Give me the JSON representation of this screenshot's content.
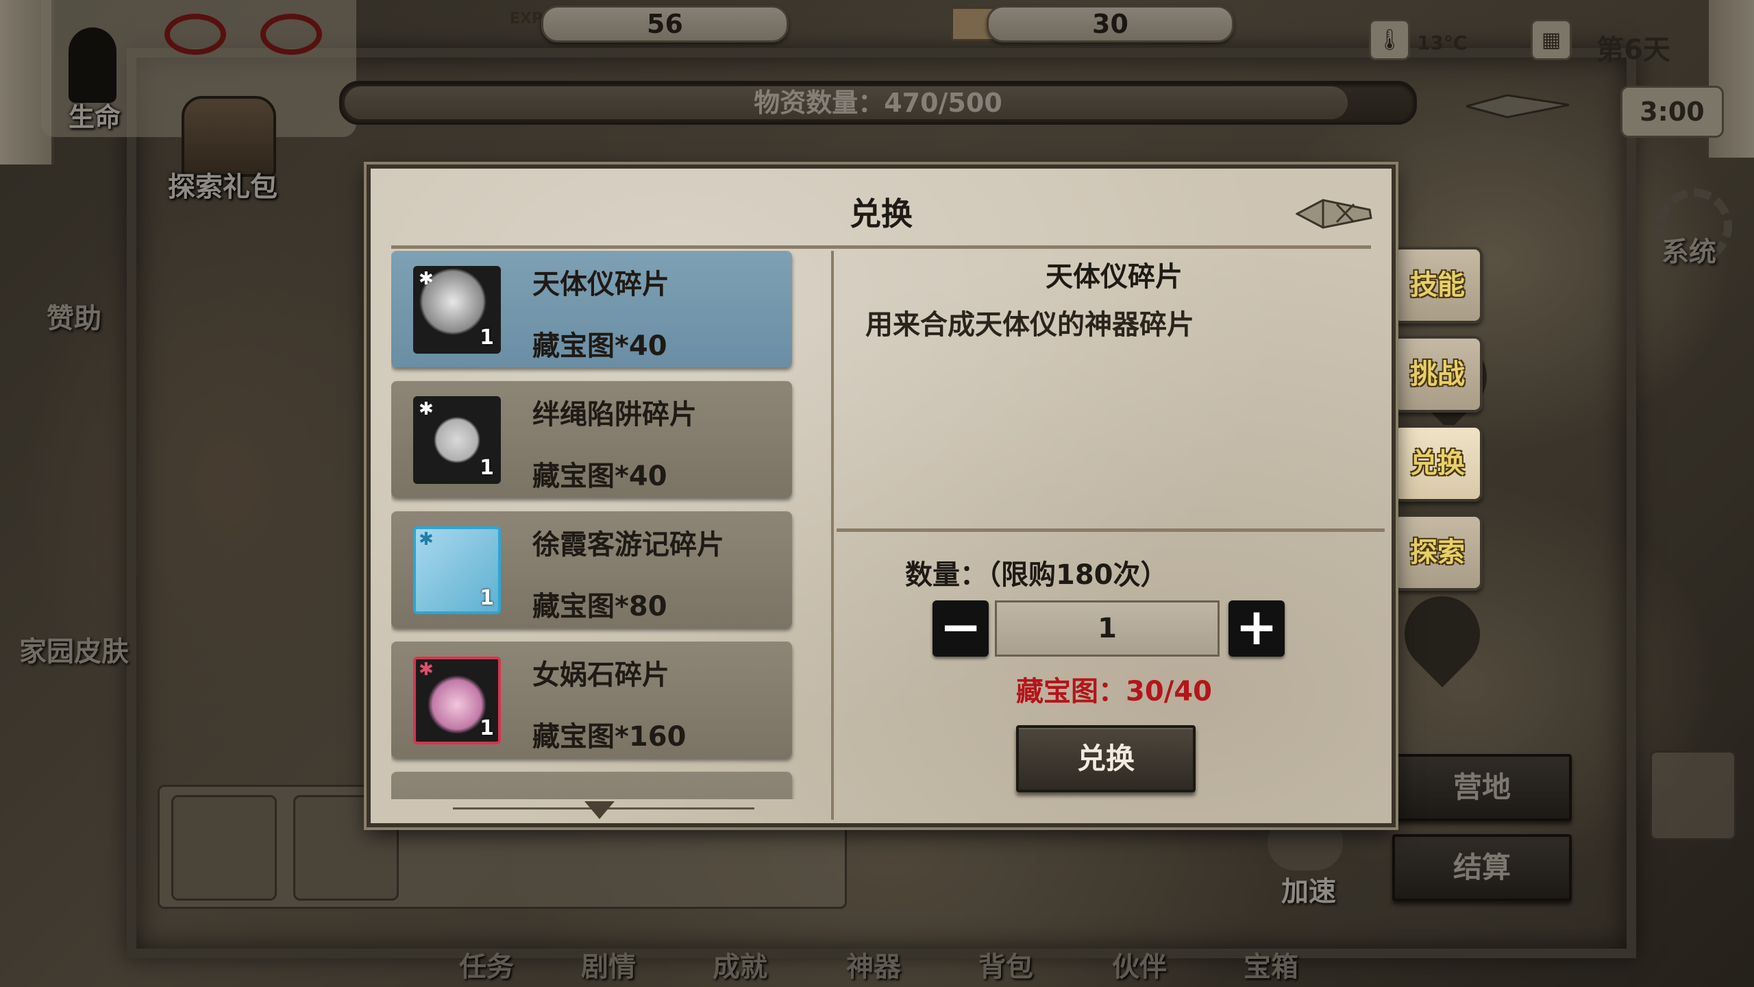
{
  "hud": {
    "exp_icon_text": "EXP",
    "exp_value": "56",
    "scroll_value": "30",
    "temperature": "13°C",
    "day": "第6天",
    "time": "3:00",
    "life_label": "生命"
  },
  "resource": {
    "text": "物资数量：470/500",
    "fill_fraction": 0.94
  },
  "left_side": {
    "gift_label": "探索礼包",
    "sponsor_label": "赞助",
    "skin_label": "家园皮肤"
  },
  "right_side": {
    "system_label": "系统",
    "camp_label": "营地",
    "settle_label": "结算",
    "speed_label": "加速"
  },
  "dialog": {
    "title": "兑换",
    "items": [
      {
        "name": "天体仪碎片",
        "cost": "藏宝图*40",
        "qty": "1",
        "icon": "celestial-globe-icon",
        "frame": "#1b1b1b",
        "selected": true
      },
      {
        "name": "绊绳陷阱碎片",
        "cost": "藏宝图*40",
        "qty": "1",
        "icon": "rope-trap-icon",
        "frame": "#1b1b1b",
        "selected": false
      },
      {
        "name": "徐霞客游记碎片",
        "cost": "藏宝图*80",
        "qty": "1",
        "icon": "travel-journal-icon",
        "frame": "#2aa7d6",
        "selected": false
      },
      {
        "name": "女娲石碎片",
        "cost": "藏宝图*160",
        "qty": "1",
        "icon": "nuwa-stone-icon",
        "frame": "#d6344e",
        "selected": false
      }
    ],
    "detail_name": "天体仪碎片",
    "detail_desc": "用来合成天体仪的神器碎片",
    "qty_label": "数量：（限购180次）",
    "qty_value": "1",
    "minus_label": "−",
    "plus_label": "+",
    "cost_status": "藏宝图：30/40",
    "exchange_button": "兑换"
  },
  "side_tabs": [
    "技能",
    "挑战",
    "兑换",
    "探索"
  ],
  "active_tab": "兑换",
  "bottom_nav": [
    "任务",
    "剧情",
    "成就",
    "神器",
    "背包",
    "伙伴",
    "宝箱"
  ],
  "colors": {
    "selected_item": "#6a8ea4",
    "warning_red": "#b4151a",
    "tab_text": "#e9cf6a"
  }
}
